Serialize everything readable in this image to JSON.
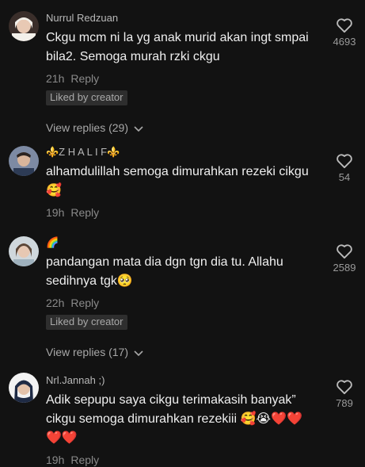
{
  "comments": [
    {
      "username": "Nurrul Redzuan",
      "text": "Ckgu mcm ni la yg anak murid akan ingt smpai bila2. Semoga murah rzki ckgu",
      "time": "21h",
      "reply_label": "Reply",
      "liked_by_creator": "Liked by creator",
      "view_replies": "View replies (29)",
      "likes": "4693"
    },
    {
      "username": "⚜️Z H A L I F⚜️",
      "text": "alhamdulillah semoga dimurahkan rezeki cikgu🥰",
      "time": "19h",
      "reply_label": "Reply",
      "likes": "54"
    },
    {
      "username": "🌈",
      "text": "pandangan mata dia dgn tgn dia tu. Allahu sedihnya tgk🥺",
      "time": "22h",
      "reply_label": "Reply",
      "liked_by_creator": "Liked by creator",
      "view_replies": "View replies (17)",
      "likes": "2589"
    },
    {
      "username": "Nrl.Jannah ;)",
      "text": "Adik sepupu saya cikgu terimakasih banyak” cikgu semoga dimurahkan rezekiii 🥰😭❤️❤️❤️❤️",
      "time": "19h",
      "reply_label": "Reply",
      "likes": "789"
    }
  ],
  "colors": {
    "background": "#121212",
    "username": "#b8b8b8",
    "meta": "#8a8a8a",
    "badge_bg": "#2e2e2e"
  },
  "icons": {
    "like": "heart-outline-icon",
    "expand": "chevron-down-icon"
  }
}
